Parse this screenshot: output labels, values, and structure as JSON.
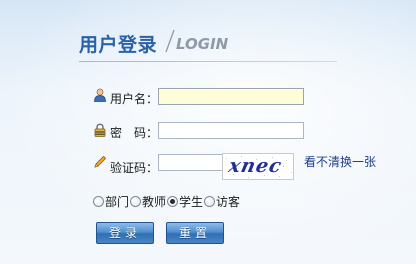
{
  "header": {
    "title": "用户登录",
    "subtitle": "LOGIN"
  },
  "form": {
    "username": {
      "label": "用户名：",
      "value": "",
      "icon": "user-icon"
    },
    "password": {
      "label": "密　码：",
      "value": "",
      "icon": "lock-icon"
    },
    "captcha": {
      "label": "验证码：",
      "value": "",
      "icon": "pencil-icon",
      "image_text": "xnec",
      "refresh_text": "看不清换一张"
    },
    "roles": {
      "options": [
        {
          "label": "部门",
          "checked": false
        },
        {
          "label": "教师",
          "checked": false
        },
        {
          "label": "学生",
          "checked": true
        },
        {
          "label": "访客",
          "checked": false
        }
      ]
    }
  },
  "buttons": {
    "login": "登录",
    "reset": "重置"
  },
  "colors": {
    "title": "#2a62a8",
    "subtitle": "#8f9aa6",
    "button": "#3f7fc0",
    "active_input": "#fefdd9"
  }
}
